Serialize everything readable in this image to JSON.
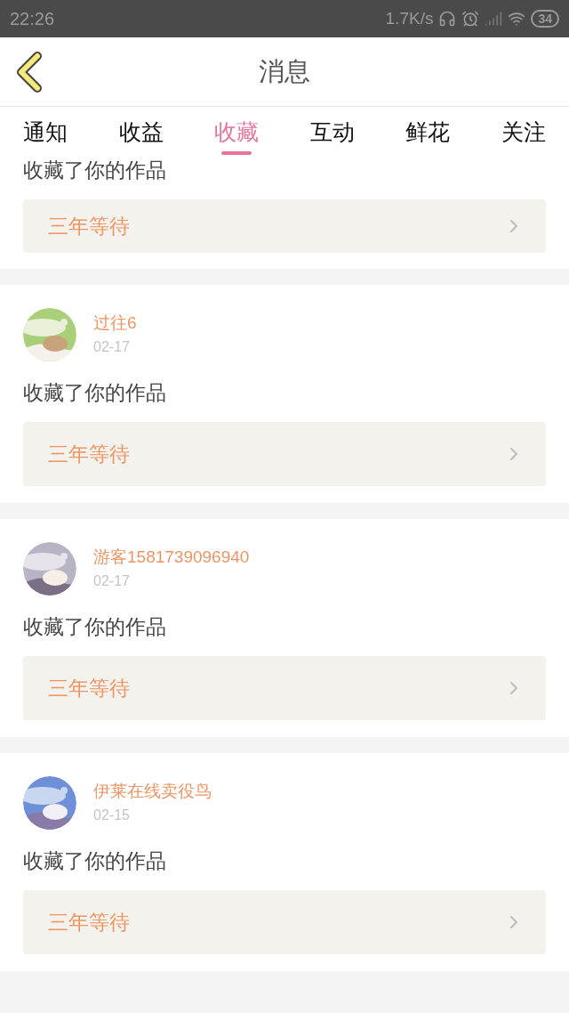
{
  "status_bar": {
    "time": "22:26",
    "net_speed": "1.7K/s",
    "battery": "34"
  },
  "header": {
    "title": "消息"
  },
  "tabs": [
    {
      "label": "通知",
      "selected": false
    },
    {
      "label": "收益",
      "selected": false
    },
    {
      "label": "收藏",
      "selected": true
    },
    {
      "label": "互动",
      "selected": false
    },
    {
      "label": "鲜花",
      "selected": false
    },
    {
      "label": "关注",
      "selected": false
    }
  ],
  "items": [
    {
      "kind": "partial",
      "text": "收藏了你的作品",
      "work": "三年等待"
    },
    {
      "kind": "full",
      "name": "过往6",
      "date": "02-17",
      "text": "收藏了你的作品",
      "work": "三年等待"
    },
    {
      "kind": "full",
      "name": "游客1581739096940",
      "date": "02-17",
      "text": "收藏了你的作品",
      "work": "三年等待"
    },
    {
      "kind": "full",
      "name": "伊莱在线卖役鸟",
      "date": "02-15",
      "text": "收藏了你的作品",
      "work": "三年等待"
    }
  ]
}
